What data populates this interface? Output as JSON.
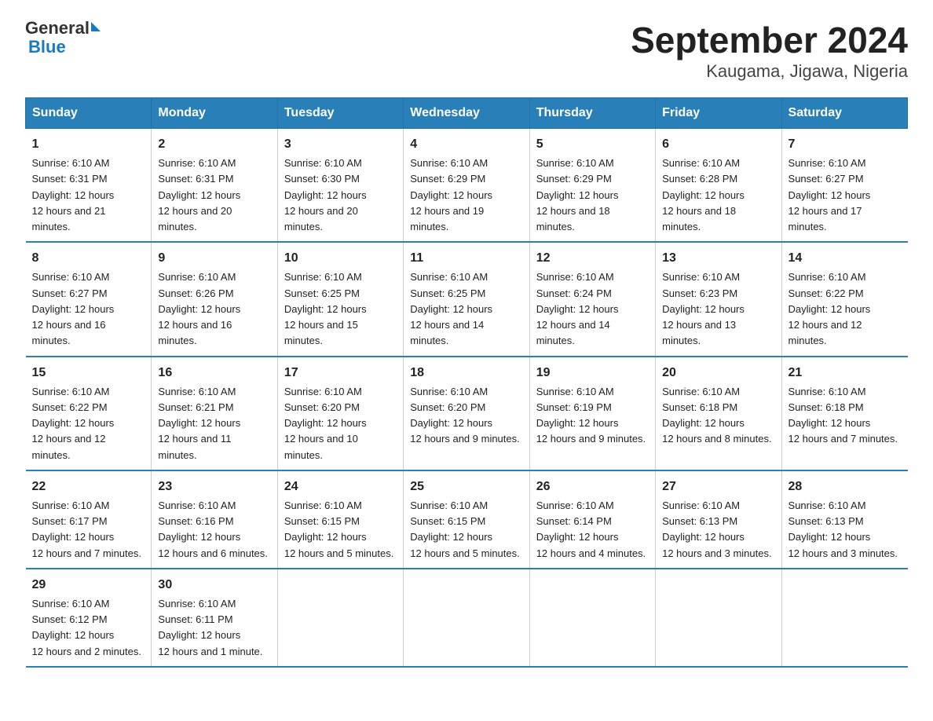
{
  "header": {
    "logo_text": "General",
    "logo_blue": "Blue",
    "title": "September 2024",
    "subtitle": "Kaugama, Jigawa, Nigeria"
  },
  "weekdays": [
    "Sunday",
    "Monday",
    "Tuesday",
    "Wednesday",
    "Thursday",
    "Friday",
    "Saturday"
  ],
  "weeks": [
    [
      {
        "day": "1",
        "sunrise": "6:10 AM",
        "sunset": "6:31 PM",
        "daylight": "12 hours and 21 minutes."
      },
      {
        "day": "2",
        "sunrise": "6:10 AM",
        "sunset": "6:31 PM",
        "daylight": "12 hours and 20 minutes."
      },
      {
        "day": "3",
        "sunrise": "6:10 AM",
        "sunset": "6:30 PM",
        "daylight": "12 hours and 20 minutes."
      },
      {
        "day": "4",
        "sunrise": "6:10 AM",
        "sunset": "6:29 PM",
        "daylight": "12 hours and 19 minutes."
      },
      {
        "day": "5",
        "sunrise": "6:10 AM",
        "sunset": "6:29 PM",
        "daylight": "12 hours and 18 minutes."
      },
      {
        "day": "6",
        "sunrise": "6:10 AM",
        "sunset": "6:28 PM",
        "daylight": "12 hours and 18 minutes."
      },
      {
        "day": "7",
        "sunrise": "6:10 AM",
        "sunset": "6:27 PM",
        "daylight": "12 hours and 17 minutes."
      }
    ],
    [
      {
        "day": "8",
        "sunrise": "6:10 AM",
        "sunset": "6:27 PM",
        "daylight": "12 hours and 16 minutes."
      },
      {
        "day": "9",
        "sunrise": "6:10 AM",
        "sunset": "6:26 PM",
        "daylight": "12 hours and 16 minutes."
      },
      {
        "day": "10",
        "sunrise": "6:10 AM",
        "sunset": "6:25 PM",
        "daylight": "12 hours and 15 minutes."
      },
      {
        "day": "11",
        "sunrise": "6:10 AM",
        "sunset": "6:25 PM",
        "daylight": "12 hours and 14 minutes."
      },
      {
        "day": "12",
        "sunrise": "6:10 AM",
        "sunset": "6:24 PM",
        "daylight": "12 hours and 14 minutes."
      },
      {
        "day": "13",
        "sunrise": "6:10 AM",
        "sunset": "6:23 PM",
        "daylight": "12 hours and 13 minutes."
      },
      {
        "day": "14",
        "sunrise": "6:10 AM",
        "sunset": "6:22 PM",
        "daylight": "12 hours and 12 minutes."
      }
    ],
    [
      {
        "day": "15",
        "sunrise": "6:10 AM",
        "sunset": "6:22 PM",
        "daylight": "12 hours and 12 minutes."
      },
      {
        "day": "16",
        "sunrise": "6:10 AM",
        "sunset": "6:21 PM",
        "daylight": "12 hours and 11 minutes."
      },
      {
        "day": "17",
        "sunrise": "6:10 AM",
        "sunset": "6:20 PM",
        "daylight": "12 hours and 10 minutes."
      },
      {
        "day": "18",
        "sunrise": "6:10 AM",
        "sunset": "6:20 PM",
        "daylight": "12 hours and 9 minutes."
      },
      {
        "day": "19",
        "sunrise": "6:10 AM",
        "sunset": "6:19 PM",
        "daylight": "12 hours and 9 minutes."
      },
      {
        "day": "20",
        "sunrise": "6:10 AM",
        "sunset": "6:18 PM",
        "daylight": "12 hours and 8 minutes."
      },
      {
        "day": "21",
        "sunrise": "6:10 AM",
        "sunset": "6:18 PM",
        "daylight": "12 hours and 7 minutes."
      }
    ],
    [
      {
        "day": "22",
        "sunrise": "6:10 AM",
        "sunset": "6:17 PM",
        "daylight": "12 hours and 7 minutes."
      },
      {
        "day": "23",
        "sunrise": "6:10 AM",
        "sunset": "6:16 PM",
        "daylight": "12 hours and 6 minutes."
      },
      {
        "day": "24",
        "sunrise": "6:10 AM",
        "sunset": "6:15 PM",
        "daylight": "12 hours and 5 minutes."
      },
      {
        "day": "25",
        "sunrise": "6:10 AM",
        "sunset": "6:15 PM",
        "daylight": "12 hours and 5 minutes."
      },
      {
        "day": "26",
        "sunrise": "6:10 AM",
        "sunset": "6:14 PM",
        "daylight": "12 hours and 4 minutes."
      },
      {
        "day": "27",
        "sunrise": "6:10 AM",
        "sunset": "6:13 PM",
        "daylight": "12 hours and 3 minutes."
      },
      {
        "day": "28",
        "sunrise": "6:10 AM",
        "sunset": "6:13 PM",
        "daylight": "12 hours and 3 minutes."
      }
    ],
    [
      {
        "day": "29",
        "sunrise": "6:10 AM",
        "sunset": "6:12 PM",
        "daylight": "12 hours and 2 minutes."
      },
      {
        "day": "30",
        "sunrise": "6:10 AM",
        "sunset": "6:11 PM",
        "daylight": "12 hours and 1 minute."
      },
      null,
      null,
      null,
      null,
      null
    ]
  ]
}
